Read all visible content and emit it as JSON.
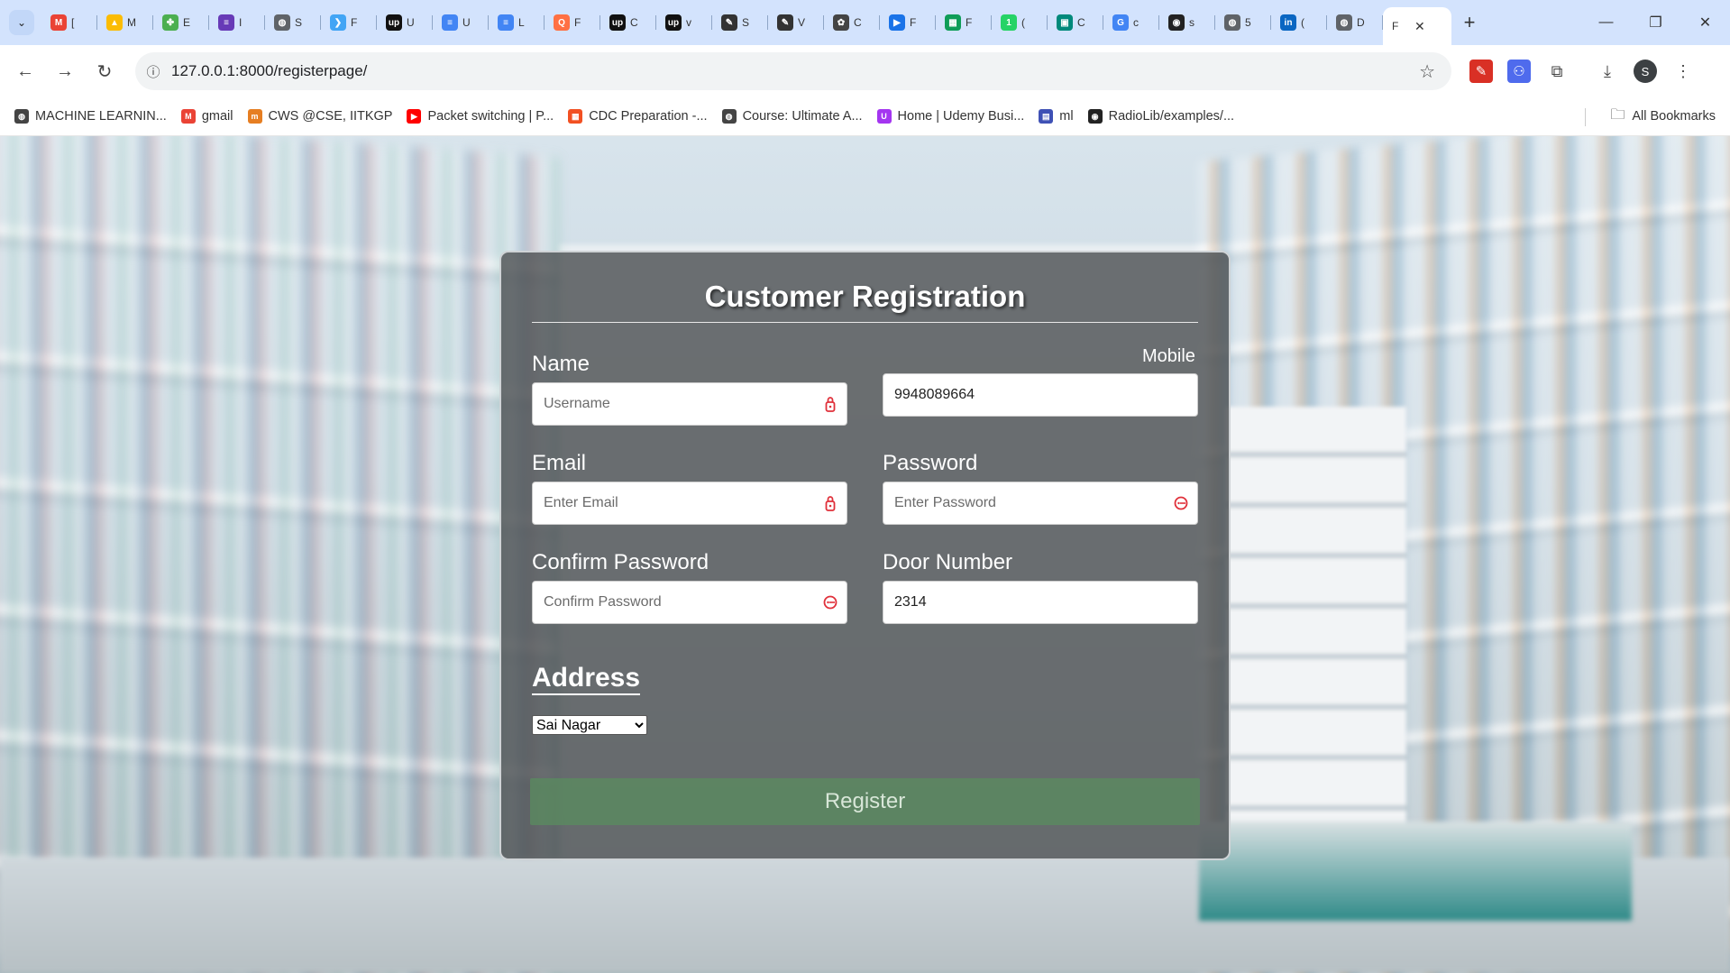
{
  "browser": {
    "tabs": [
      {
        "title": "[",
        "favicon": "gmail-icon",
        "color": "#ea4335",
        "glyph": "M"
      },
      {
        "title": "M",
        "favicon": "drive-icon",
        "color": "#fbbc04",
        "glyph": "▲"
      },
      {
        "title": "E",
        "favicon": "pinwheel-icon",
        "color": "#4caf50",
        "glyph": "✤"
      },
      {
        "title": "I",
        "favicon": "document-icon",
        "color": "#673ab7",
        "glyph": "≡"
      },
      {
        "title": "S",
        "favicon": "globe-icon",
        "color": "#5f6368",
        "glyph": "◍"
      },
      {
        "title": "F",
        "favicon": "flutter-icon",
        "color": "#42a5f5",
        "glyph": "❯"
      },
      {
        "title": "U",
        "favicon": "upwork-icon",
        "color": "#111111",
        "glyph": "up"
      },
      {
        "title": "U",
        "favicon": "docs-icon",
        "color": "#4285f4",
        "glyph": "≡"
      },
      {
        "title": "L",
        "favicon": "docs-icon",
        "color": "#4285f4",
        "glyph": "≡"
      },
      {
        "title": "F",
        "favicon": "orange-icon",
        "color": "#ff7043",
        "glyph": "Q"
      },
      {
        "title": "C",
        "favicon": "upwork-icon",
        "color": "#111111",
        "glyph": "up"
      },
      {
        "title": "v",
        "favicon": "upwork-icon",
        "color": "#111111",
        "glyph": "up"
      },
      {
        "title": "S",
        "favicon": "pen-icon",
        "color": "#333333",
        "glyph": "✎"
      },
      {
        "title": "V",
        "favicon": "pen-icon",
        "color": "#333333",
        "glyph": "✎"
      },
      {
        "title": "C",
        "favicon": "openai-icon",
        "color": "#444444",
        "glyph": "✿"
      },
      {
        "title": "F",
        "favicon": "play-icon",
        "color": "#1a73e8",
        "glyph": "▶"
      },
      {
        "title": "F",
        "favicon": "sheets-icon",
        "color": "#0f9d58",
        "glyph": "▦"
      },
      {
        "title": "(",
        "favicon": "whatsapp-icon",
        "color": "#25d366",
        "glyph": "1"
      },
      {
        "title": "C",
        "favicon": "meet-icon",
        "color": "#00897b",
        "glyph": "▣"
      },
      {
        "title": "c",
        "favicon": "google-icon",
        "color": "#4285f4",
        "glyph": "G"
      },
      {
        "title": "s",
        "favicon": "github-icon",
        "color": "#222222",
        "glyph": "◉"
      },
      {
        "title": "5",
        "favicon": "globe-icon",
        "color": "#5f6368",
        "glyph": "◍"
      },
      {
        "title": "(",
        "favicon": "linkedin-icon",
        "color": "#0a66c2",
        "glyph": "in"
      },
      {
        "title": "D",
        "favicon": "globe-icon",
        "color": "#5f6368",
        "glyph": "◍"
      }
    ],
    "active_tab_title": "F",
    "url": "127.0.0.1:8000/registerpage/",
    "profile_initial": "S",
    "bookmarks": [
      {
        "label": "MACHINE LEARNIN...",
        "icon": "globe-icon",
        "color": "#444444",
        "glyph": "◍"
      },
      {
        "label": "gmail",
        "icon": "gmail-icon",
        "color": "#ea4335",
        "glyph": "M"
      },
      {
        "label": "CWS @CSE, IITKGP",
        "icon": "cws-icon",
        "color": "#e67e22",
        "glyph": "m"
      },
      {
        "label": "Packet switching | P...",
        "icon": "youtube-icon",
        "color": "#ff0000",
        "glyph": "▶"
      },
      {
        "label": "CDC Preparation -...",
        "icon": "windows-icon",
        "color": "#f25022",
        "glyph": "▦"
      },
      {
        "label": "Course: Ultimate A...",
        "icon": "globe-icon",
        "color": "#444444",
        "glyph": "◍"
      },
      {
        "label": "Home | Udemy Busi...",
        "icon": "udemy-icon",
        "color": "#a435f0",
        "glyph": "U"
      },
      {
        "label": "ml",
        "icon": "calendar-icon",
        "color": "#3f51b5",
        "glyph": "▤"
      },
      {
        "label": "RadioLib/examples/...",
        "icon": "github-icon",
        "color": "#222222",
        "glyph": "◉"
      }
    ],
    "all_bookmarks_label": "All Bookmarks"
  },
  "form": {
    "title": "Customer Registration",
    "name_label": "Name",
    "name_placeholder": "Username",
    "mobile_label": "Mobile",
    "mobile_value": "9948089664",
    "email_label": "Email",
    "email_placeholder": "Enter Email",
    "password_label": "Password",
    "password_placeholder": "Enter Password",
    "confirm_label": "Confirm Password",
    "confirm_placeholder": "Confirm Password",
    "door_label": "Door Number",
    "door_value": "2314",
    "address_label": "Address",
    "address_selected": "Sai Nagar",
    "register_label": "Register"
  }
}
